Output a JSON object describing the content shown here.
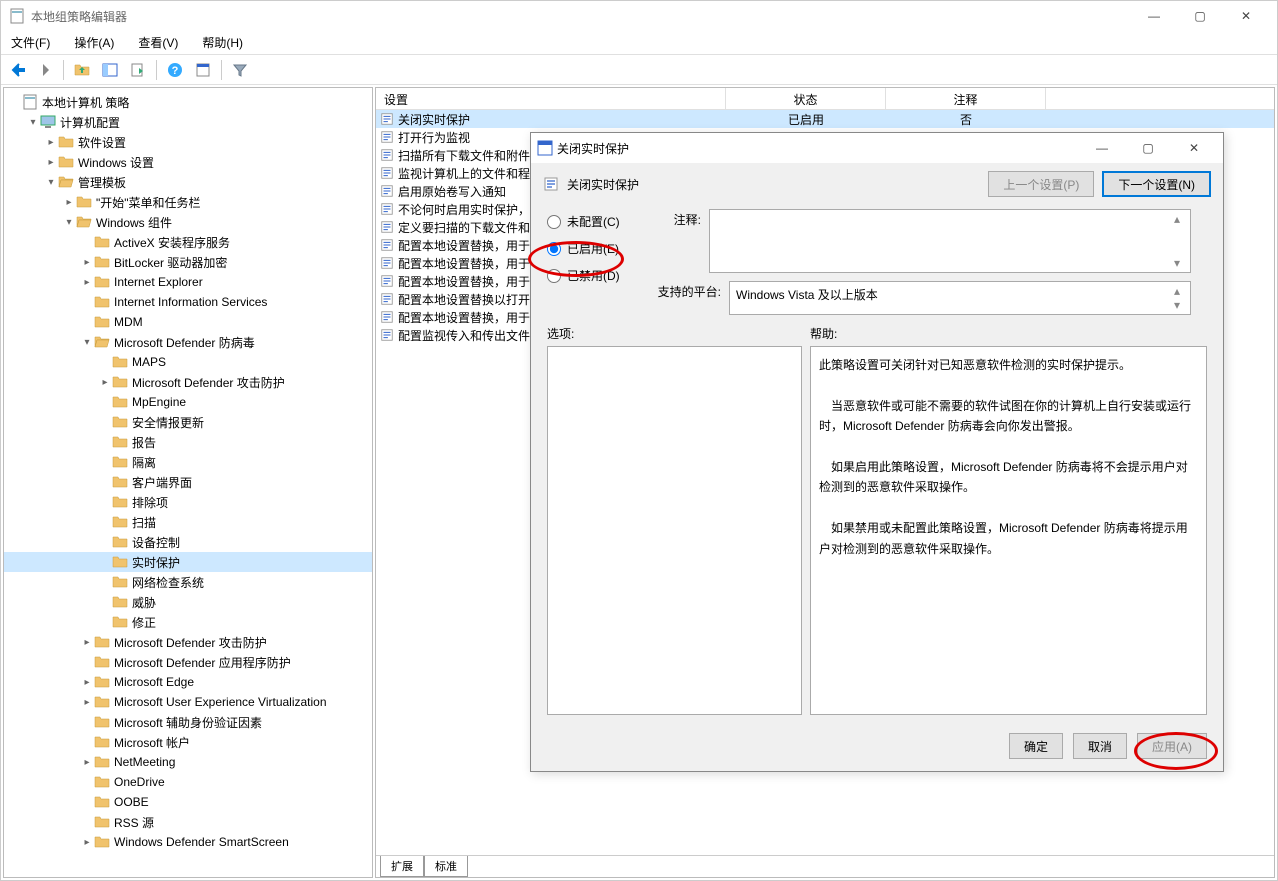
{
  "window": {
    "title": "本地组策略编辑器",
    "menus": {
      "file": "文件(F)",
      "action": "操作(A)",
      "view": "查看(V)",
      "help": "帮助(H)"
    },
    "sysbtns": {
      "min": "—",
      "max": "▢",
      "close": "✕"
    }
  },
  "tree": {
    "root": "本地计算机 策略",
    "computer_config": "计算机配置",
    "software_settings": "软件设置",
    "windows_settings": "Windows 设置",
    "admin_templates": "管理模板",
    "start_taskbar": "\"开始\"菜单和任务栏",
    "windows_components": "Windows 组件",
    "activex": "ActiveX 安装程序服务",
    "bitlocker": "BitLocker 驱动器加密",
    "ie": "Internet Explorer",
    "iis": "Internet Information Services",
    "mdm": "MDM",
    "defender_av": "Microsoft Defender 防病毒",
    "maps": "MAPS",
    "defender_atk": "Microsoft Defender 攻击防护",
    "mpengine": "MpEngine",
    "sec_intel": "安全情报更新",
    "report": "报告",
    "quarantine": "隔离",
    "client_ui": "客户端界面",
    "exclusions": "排除项",
    "scan": "扫描",
    "device_control": "设备控制",
    "realtime": "实时保护",
    "netinspect": "网络检查系统",
    "threat": "威胁",
    "fix": "修正",
    "defender_atk2": "Microsoft Defender 攻击防护",
    "defender_app": "Microsoft Defender 应用程序防护",
    "edge": "Microsoft Edge",
    "muev": "Microsoft User Experience Virtualization",
    "mfa": "Microsoft 辅助身份验证因素",
    "ms_account": "Microsoft 帐户",
    "netmeeting": "NetMeeting",
    "onedrive": "OneDrive",
    "oobe": "OOBE",
    "rss": "RSS 源",
    "smartscreen": "Windows Defender SmartScreen"
  },
  "list": {
    "headers": {
      "setting": "设置",
      "state": "状态",
      "comment": "注释"
    },
    "rows": [
      {
        "name": "关闭实时保护",
        "state": "已启用",
        "comment": "否",
        "sel": true
      },
      {
        "name": "打开行为监视",
        "state": "",
        "comment": ""
      },
      {
        "name": "扫描所有下载文件和附件",
        "state": "",
        "comment": ""
      },
      {
        "name": "监视计算机上的文件和程序活动",
        "state": "",
        "comment": ""
      },
      {
        "name": "启用原始卷写入通知",
        "state": "",
        "comment": ""
      },
      {
        "name": "不论何时启用实时保护，都打开进程扫描",
        "state": "",
        "comment": ""
      },
      {
        "name": "定义要扫描的下载文件和附件的最大大小",
        "state": "",
        "comment": ""
      },
      {
        "name": "配置本地设置替换，用于监视计算机上的文件和程序活动",
        "state": "",
        "comment": ""
      },
      {
        "name": "配置本地设置替换，用于监视传入和传出文件活动",
        "state": "",
        "comment": ""
      },
      {
        "name": "配置本地设置替换，用于扫描所有下载文件和附件",
        "state": "",
        "comment": ""
      },
      {
        "name": "配置本地设置替换以打开行为监视",
        "state": "",
        "comment": ""
      },
      {
        "name": "配置本地设置替换，用于打开实时保护",
        "state": "",
        "comment": ""
      },
      {
        "name": "配置监视传入和传出文件和程序活动",
        "state": "",
        "comment": ""
      }
    ],
    "tabs": {
      "extended": "扩展",
      "standard": "标准"
    }
  },
  "dialog": {
    "title": "关闭实时保护",
    "policy_name": "关闭实时保护",
    "prev": "上一个设置(P)",
    "next": "下一个设置(N)",
    "radio_unconfigured": "未配置(C)",
    "radio_enabled": "已启用(E)",
    "radio_disabled": "已禁用(D)",
    "comment_label": "注释:",
    "supported_label": "支持的平台:",
    "supported_value": "Windows Vista 及以上版本",
    "options_label": "选项:",
    "help_label": "帮助:",
    "help_p1": "此策略设置可关闭针对已知恶意软件检测的实时保护提示。",
    "help_p2": "　当恶意软件或可能不需要的软件试图在你的计算机上自行安装或运行时，Microsoft Defender 防病毒会向你发出警报。",
    "help_p3": "　如果启用此策略设置，Microsoft Defender 防病毒将不会提示用户对检测到的恶意软件采取操作。",
    "help_p4": "　如果禁用或未配置此策略设置，Microsoft Defender 防病毒将提示用户对检测到的恶意软件采取操作。",
    "ok": "确定",
    "cancel": "取消",
    "apply": "应用(A)"
  }
}
